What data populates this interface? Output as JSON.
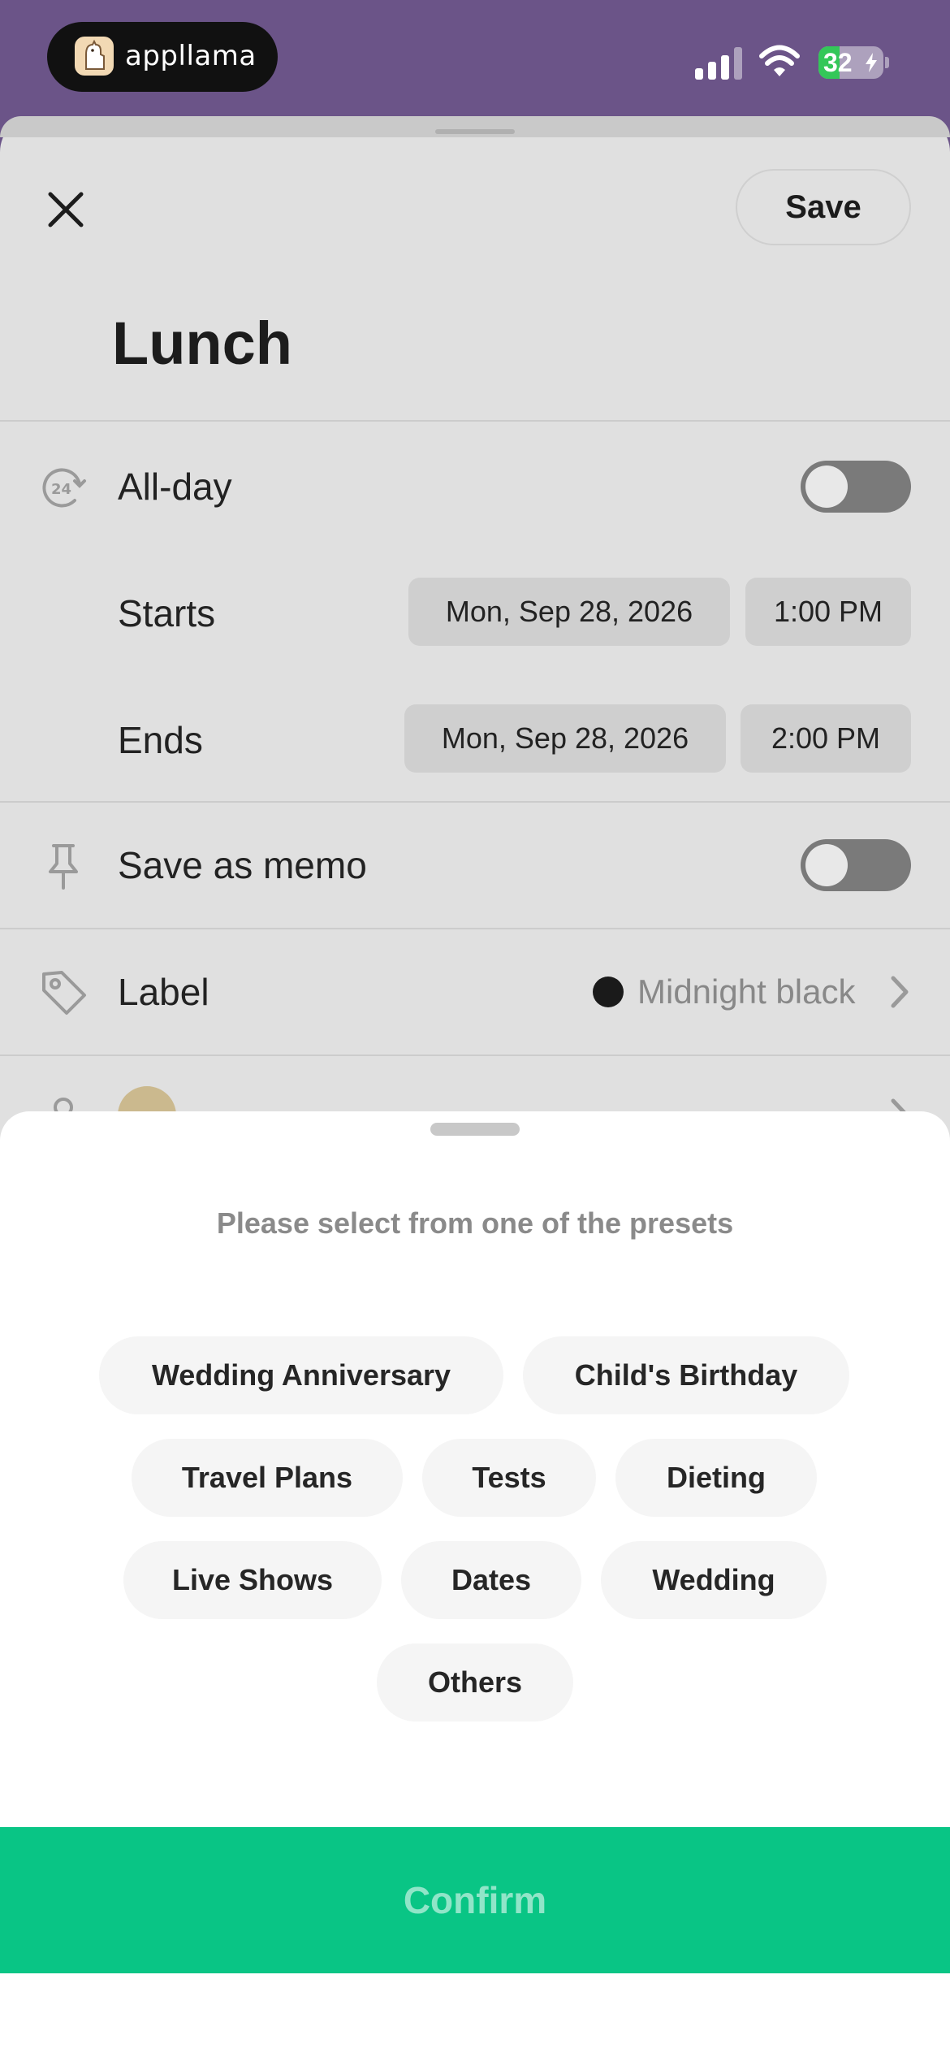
{
  "status_bar": {
    "app_name": "appllama",
    "battery_level": "32",
    "battery_fraction": 0.32,
    "signal_bars": 3,
    "icons": [
      "signal-icon",
      "wifi-icon",
      "battery-charging-icon"
    ]
  },
  "event_editor": {
    "save_label": "Save",
    "title": "Lunch",
    "all_day": {
      "label": "All-day",
      "on": false
    },
    "starts": {
      "label": "Starts",
      "date": "Mon, Sep 28, 2026",
      "time": "1:00 PM"
    },
    "ends": {
      "label": "Ends",
      "date": "Mon, Sep 28, 2026",
      "time": "2:00 PM"
    },
    "memo": {
      "label": "Save as memo",
      "on": false
    },
    "label_row": {
      "label": "Label",
      "value": "Midnight black",
      "color": "#1a1a1a"
    }
  },
  "preset_sheet": {
    "prompt": "Please select from one of the presets",
    "presets": [
      "Wedding Anniversary",
      "Child's Birthday",
      "Travel Plans",
      "Tests",
      "Dieting",
      "Live Shows",
      "Dates",
      "Wedding",
      "Others"
    ],
    "confirm_label": "Confirm"
  },
  "colors": {
    "status_bar_bg": "#6b5488",
    "confirm_green": "#09c585",
    "dim_sheet": "#e0e0e0"
  }
}
